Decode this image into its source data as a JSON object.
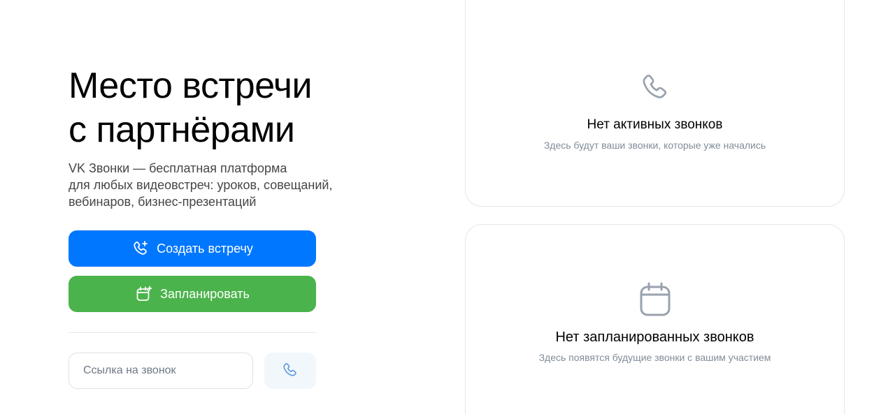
{
  "hero": {
    "title_line1": "Место встречи",
    "title_line2": "с партнёрами",
    "desc_line1": "VK Звонки — бесплатная платформа",
    "desc_line2": "для любых видеовстреч: уроков, совещаний,",
    "desc_line3": "вебинаров, бизнес-презентаций"
  },
  "actions": {
    "create_label": "Создать встречу",
    "create_icon": "phone-add-icon",
    "plan_label": "Запланировать",
    "plan_icon": "calendar-add-icon"
  },
  "join": {
    "placeholder": "Ссылка на звонок",
    "value": "",
    "call_icon": "phone-icon"
  },
  "active_calls": {
    "icon": "phone-icon",
    "title": "Нет активных звонков",
    "subtitle": "Здесь будут ваши звонки, которые уже начались"
  },
  "planned_calls": {
    "icon": "calendar-icon",
    "title": "Нет запланированных звонков",
    "subtitle": "Здесь появятся будущие звонки с вашим участием"
  },
  "colors": {
    "primary_blue": "#0077ff",
    "green": "#4bb34b",
    "call_button_bg": "#f2f7fc",
    "icon_gray": "#99a2ad",
    "subtitle_gray": "#818c99"
  }
}
